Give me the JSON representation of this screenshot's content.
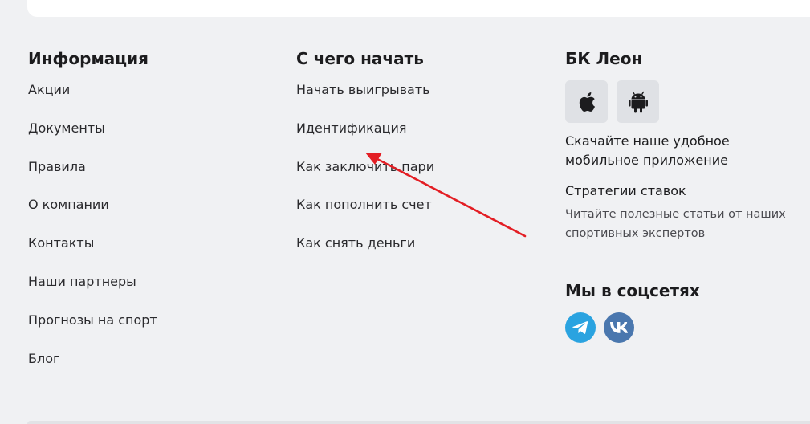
{
  "info": {
    "heading": "Информация",
    "links": [
      "Акции",
      "Документы",
      "Правила",
      "О компании",
      "Контакты",
      "Наши партнеры",
      "Прогнозы на спорт",
      "Блог"
    ]
  },
  "start": {
    "heading": "С чего начать",
    "links": [
      "Начать выигрывать",
      "Идентификация",
      "Как заключить пари",
      "Как пополнить счет",
      "Как снять деньги"
    ]
  },
  "leon": {
    "heading": "БК Леон",
    "app_text": "Скачайте наше удобное мобильное приложение",
    "strategy_title": "Стратегии ставок",
    "strategy_desc": "Читайте полезные статьи от наших спортивных экспертов"
  },
  "social": {
    "heading": "Мы в соцсетях"
  },
  "icons": {
    "apple": "apple-icon",
    "android": "android-icon",
    "telegram": "telegram-icon",
    "vk": "vk-icon"
  },
  "colors": {
    "background": "#f0f1f3",
    "app_button": "#dfe1e5",
    "telegram": "#2aa3e0",
    "vk": "#4a77ae",
    "annotation_arrow": "#e31e24"
  }
}
